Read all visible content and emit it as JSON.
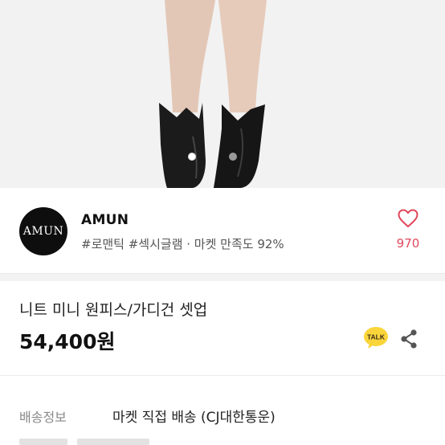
{
  "seller": {
    "logo_text": "AMUN",
    "name": "AMUN",
    "tags": "#로맨틱 #섹시글램 · 마켓 만족도 92%",
    "like_count": "970"
  },
  "product": {
    "title": "니트 미니 원피스/가디건 셋업",
    "price": "54,400원",
    "image": {
      "subject": "legs-in-black-western-boots",
      "current_slide": 2,
      "slides_shown": 2
    }
  },
  "actions": {
    "talk_label": "TALK",
    "talk_icon": "kakao-talk-icon",
    "share_icon": "share-icon",
    "like_icon": "heart-outline-icon"
  },
  "shipping": {
    "label": "배송정보",
    "value": "마켓 직접 배송 (CJ대한통운)"
  },
  "colors": {
    "accent": "#e0485c",
    "talk_yellow": "#f9d53b",
    "logo_bg": "#0e0e0e"
  }
}
